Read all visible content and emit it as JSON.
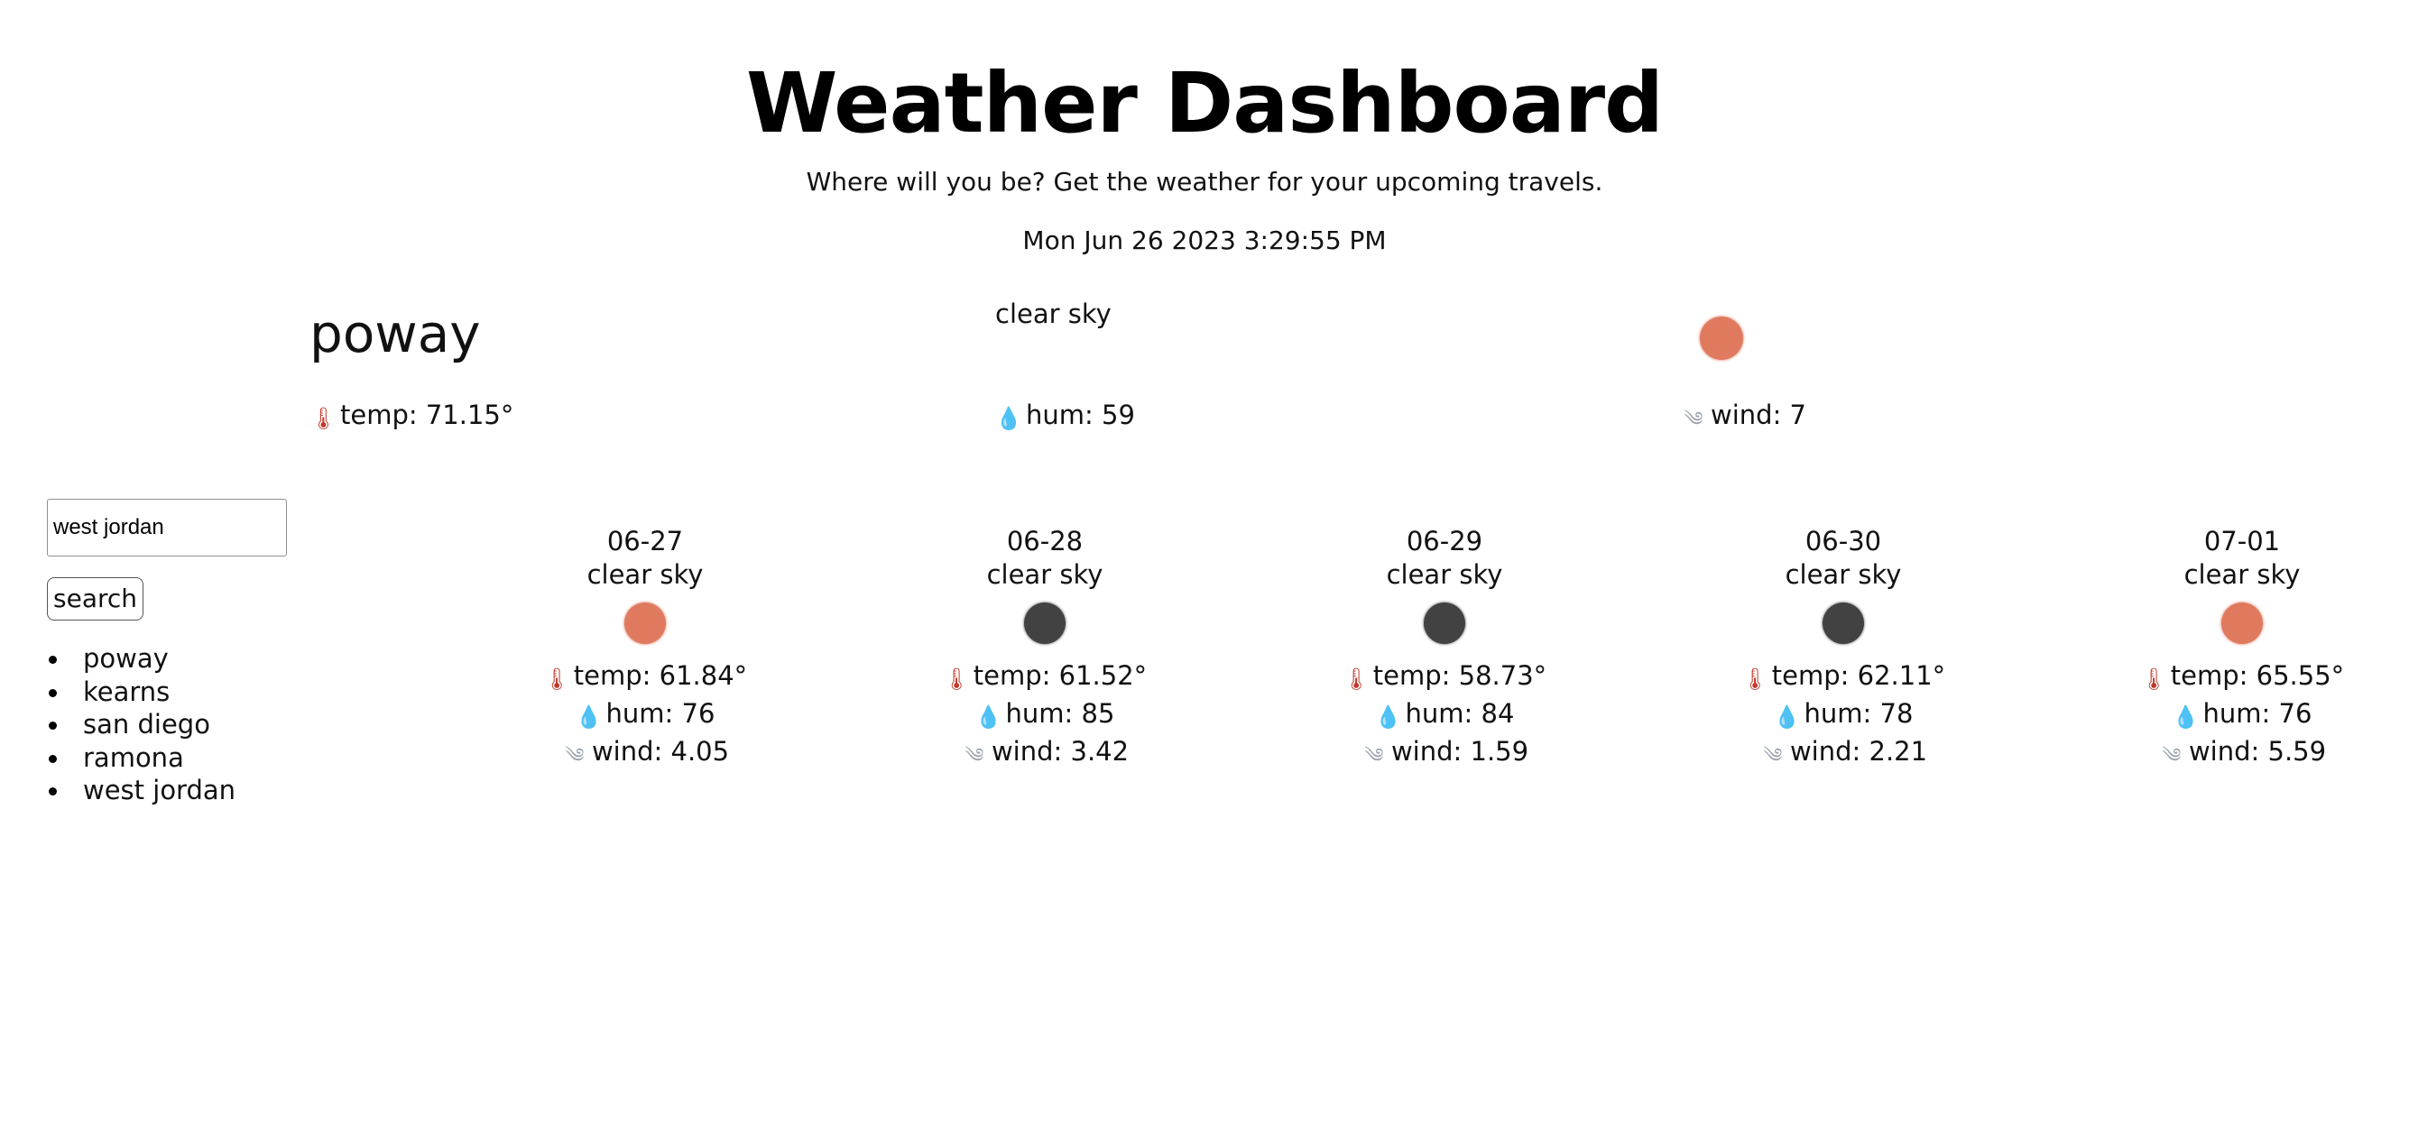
{
  "header": {
    "title": "Weather Dashboard",
    "subtitle": "Where will you be? Get the weather for your upcoming travels.",
    "datetime": "Mon Jun 26 2023 3:29:55 PM"
  },
  "current": {
    "city": "poway",
    "description": "clear sky",
    "icon": "sun-icon",
    "icon_color": "#e07a5f",
    "temp": "temp: 71.15°",
    "hum": "hum: 59",
    "wind": "wind: 7"
  },
  "search": {
    "value": "west jordan",
    "button_label": "search"
  },
  "history": [
    "poway",
    "kearns",
    "san diego",
    "ramona",
    "west jordan"
  ],
  "forecast": [
    {
      "date": "06-27",
      "description": "clear sky",
      "icon": "sun-icon",
      "icon_color": "#e07a5f",
      "temp": "temp: 61.84°",
      "hum": "hum: 76",
      "wind": "wind: 4.05"
    },
    {
      "date": "06-28",
      "description": "clear sky",
      "icon": "moon-icon",
      "icon_color": "#424242",
      "temp": "temp: 61.52°",
      "hum": "hum: 85",
      "wind": "wind: 3.42"
    },
    {
      "date": "06-29",
      "description": "clear sky",
      "icon": "moon-icon",
      "icon_color": "#424242",
      "temp": "temp: 58.73°",
      "hum": "hum: 84",
      "wind": "wind: 1.59"
    },
    {
      "date": "06-30",
      "description": "clear sky",
      "icon": "moon-icon",
      "icon_color": "#424242",
      "temp": "temp: 62.11°",
      "hum": "hum: 78",
      "wind": "wind: 2.21"
    },
    {
      "date": "07-01",
      "description": "clear sky",
      "icon": "sun-icon",
      "icon_color": "#e07a5f",
      "temp": "temp: 65.55°",
      "hum": "hum: 76",
      "wind": "wind: 5.59"
    }
  ],
  "icons": {
    "temp": "thermometer-icon",
    "hum": "droplet-icon",
    "wind": "wind-icon"
  }
}
